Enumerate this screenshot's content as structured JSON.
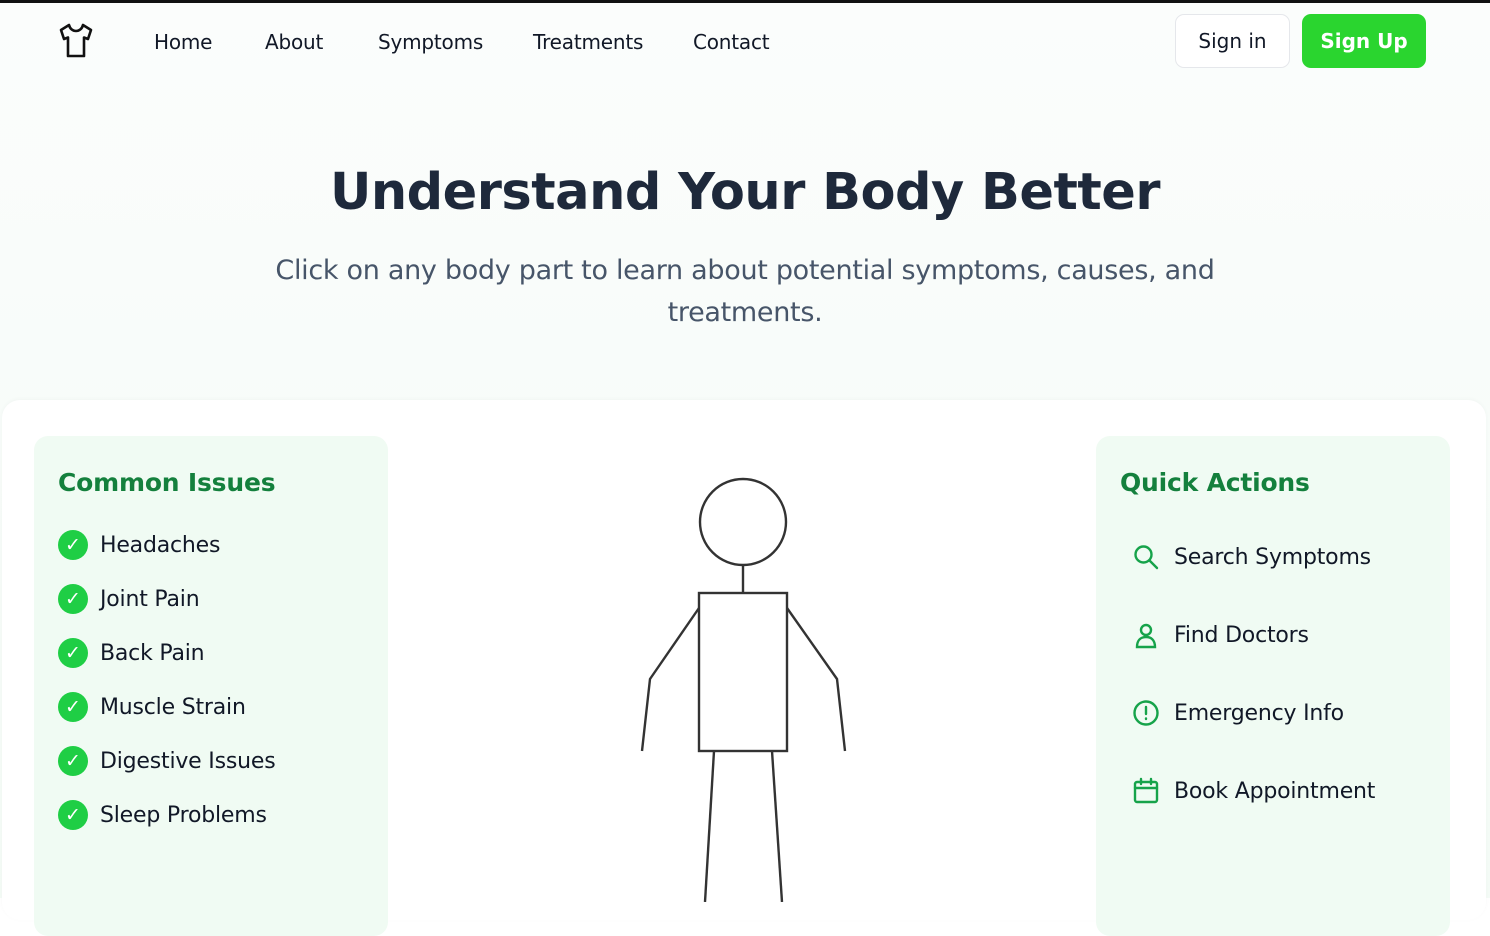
{
  "nav": {
    "logo_icon": "tshirt-icon",
    "links": [
      "Home",
      "About",
      "Symptoms",
      "Treatments",
      "Contact"
    ],
    "signin_label": "Sign in",
    "signup_label": "Sign Up"
  },
  "hero": {
    "title": "Understand Your Body Better",
    "subtitle": "Click on any body part to learn about potential symptoms, causes, and treatments."
  },
  "common_issues": {
    "title": "Common Issues",
    "check_glyph": "✓",
    "items": [
      "Headaches",
      "Joint Pain",
      "Back Pain",
      "Muscle Strain",
      "Digestive Issues",
      "Sleep Problems"
    ]
  },
  "quick_actions": {
    "title": "Quick Actions",
    "items": [
      {
        "label": "Search Symptoms",
        "icon": "search-icon"
      },
      {
        "label": "Find Doctors",
        "icon": "user-icon"
      },
      {
        "label": "Emergency Info",
        "icon": "alert-circle-icon"
      },
      {
        "label": "Book Appointment",
        "icon": "calendar-icon"
      }
    ]
  },
  "colors": {
    "accent": "#2ad52f",
    "heading_green": "#14803d",
    "panel_bg": "#f0fbf3",
    "check_green": "#1fce45",
    "icon_green": "#16a34a"
  }
}
